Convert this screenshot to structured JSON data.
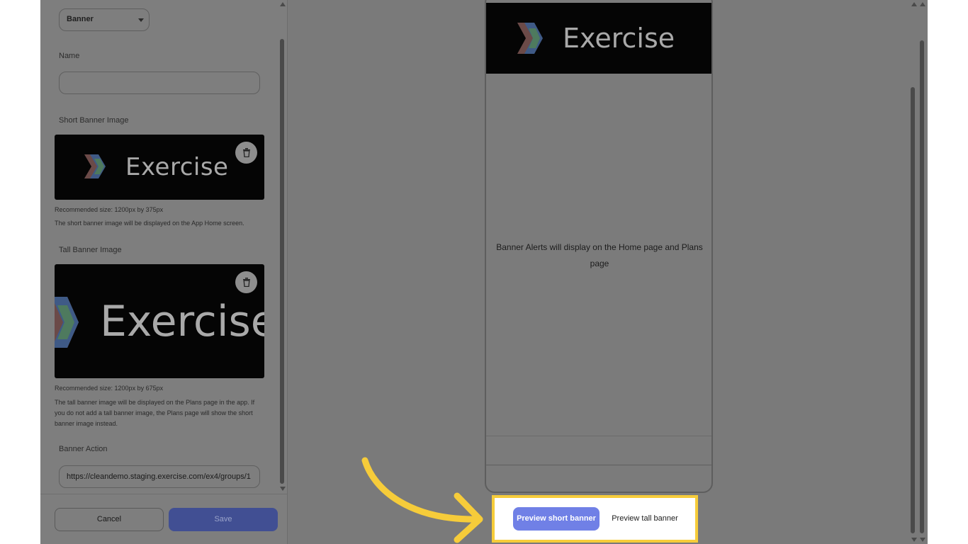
{
  "form": {
    "type_select": {
      "value": "Banner"
    },
    "name": {
      "label": "Name",
      "value": ""
    },
    "short_banner": {
      "label": "Short Banner Image",
      "image_text": "Exercise",
      "size_hint": "Recommended size: 1200px by 375px",
      "description": "The short banner image will be displayed on the App Home screen."
    },
    "tall_banner": {
      "label": "Tall Banner Image",
      "image_text": "Exercise",
      "size_hint": "Recommended size: 1200px by 675px",
      "description_lines": [
        "The tall banner image will be displayed on the Plans page in the app. If",
        "you do not add a tall banner image, the Plans page will show the short",
        "banner image instead."
      ]
    },
    "banner_action": {
      "label": "Banner Action",
      "value": "https://cleandemo.staging.exercise.com/ex4/groups/1"
    },
    "footer": {
      "cancel_label": "Cancel",
      "save_label": "Save"
    }
  },
  "preview": {
    "banner_text": "Exercise",
    "message_lines": [
      "Banner Alerts will display on the Home page and Plans",
      "page"
    ],
    "toggle": {
      "short_label": "Preview short banner",
      "tall_label": "Preview tall banner",
      "selected": "short"
    }
  },
  "colors": {
    "highlight": "#f6cc3a",
    "primary": "#7080e6",
    "save_disabled": "#414f93"
  },
  "icons": {
    "trash": "trash-icon",
    "caret": "caret-down-icon",
    "logo": "exercise-logo-icon"
  }
}
